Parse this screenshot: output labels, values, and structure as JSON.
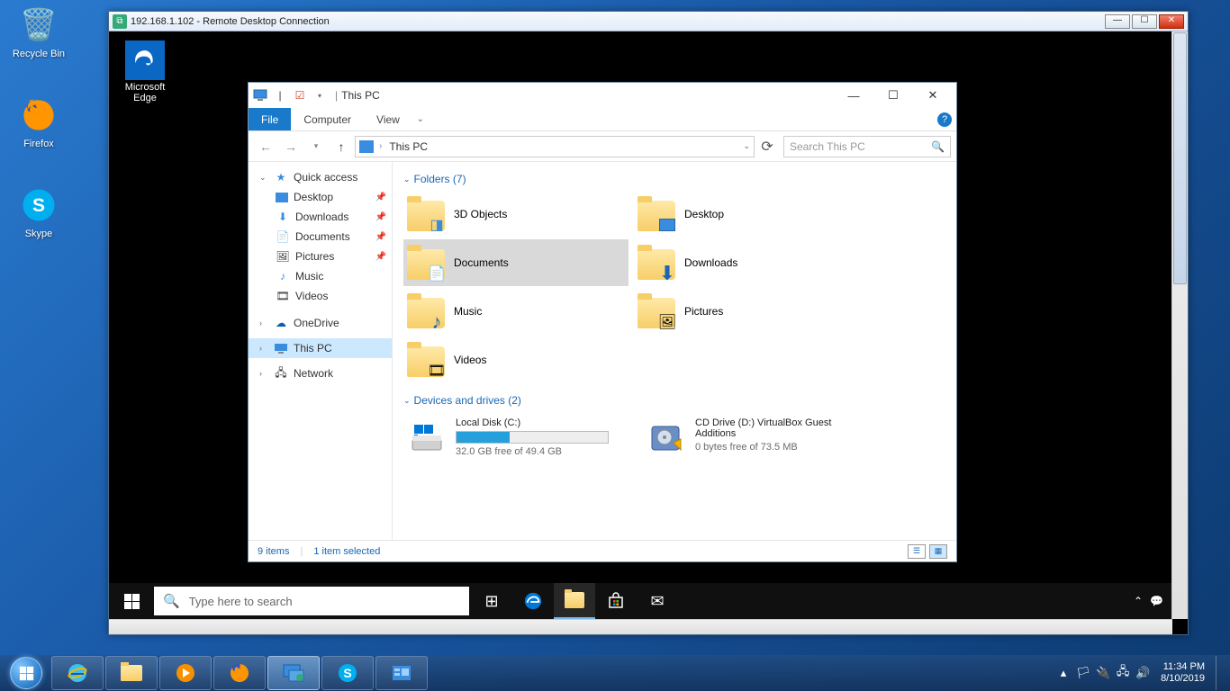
{
  "host_desktop": {
    "icons": [
      {
        "name": "recycle-bin",
        "label": "Recycle Bin"
      },
      {
        "name": "firefox",
        "label": "Firefox"
      },
      {
        "name": "skype",
        "label": "Skype"
      }
    ]
  },
  "rdp": {
    "title": "192.168.1.102 - Remote Desktop Connection"
  },
  "remote_desktop": {
    "edge_label": "Microsoft Edge"
  },
  "explorer": {
    "title": "This PC",
    "ribbon": {
      "file": "File",
      "computer": "Computer",
      "view": "View"
    },
    "breadcrumb": "This PC",
    "search_placeholder": "Search This PC",
    "nav": {
      "quick_access": "Quick access",
      "desktop": "Desktop",
      "downloads": "Downloads",
      "documents": "Documents",
      "pictures": "Pictures",
      "music": "Music",
      "videos": "Videos",
      "onedrive": "OneDrive",
      "this_pc": "This PC",
      "network": "Network"
    },
    "folders_header": "Folders (7)",
    "folders": [
      {
        "name": "3D Objects"
      },
      {
        "name": "Desktop"
      },
      {
        "name": "Documents",
        "selected": true
      },
      {
        "name": "Downloads"
      },
      {
        "name": "Music"
      },
      {
        "name": "Pictures"
      },
      {
        "name": "Videos"
      }
    ],
    "drives_header": "Devices and drives (2)",
    "drives": [
      {
        "name": "Local Disk (C:)",
        "free": "32.0 GB free of 49.4 GB",
        "fill_pct": 35
      },
      {
        "name": "CD Drive (D:) VirtualBox Guest Additions",
        "free": "0 bytes free of 73.5 MB"
      }
    ],
    "status": {
      "items": "9 items",
      "selected": "1 item selected"
    }
  },
  "remote_taskbar": {
    "search_placeholder": "Type here to search"
  },
  "host_taskbar": {
    "time": "11:34 PM",
    "date": "8/10/2019"
  }
}
